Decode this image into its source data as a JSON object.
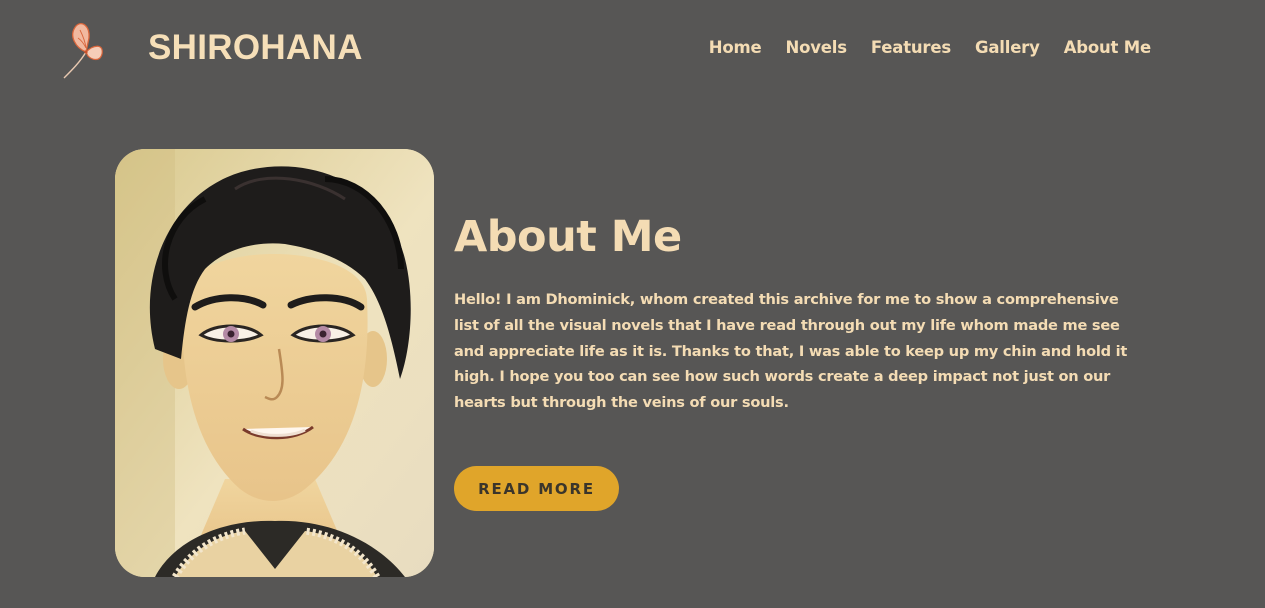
{
  "brand": {
    "name": "SHIROHANA",
    "logo_icon": "butterfly-icon"
  },
  "nav": {
    "items": [
      {
        "label": "Home"
      },
      {
        "label": "Novels"
      },
      {
        "label": "Features"
      },
      {
        "label": "Gallery"
      },
      {
        "label": "About Me"
      }
    ]
  },
  "about": {
    "title": "About Me",
    "body": "Hello! I am Dhominick, whom created this archive for me to show a comprehensive list of all the visual novels that I have read through out my life whom made me see and appreciate life as it is. Thanks to that, I was able to keep up my chin and hold it high. I hope you too can see how such words create a deep impact not just on our hearts but through the veins of our souls.",
    "button_label": "READ MORE",
    "portrait_image": "anime-style-portrait"
  },
  "colors": {
    "background": "#575655",
    "text": "#f4dcb4",
    "accent": "#e0a52a",
    "button_text": "#3a352b"
  }
}
